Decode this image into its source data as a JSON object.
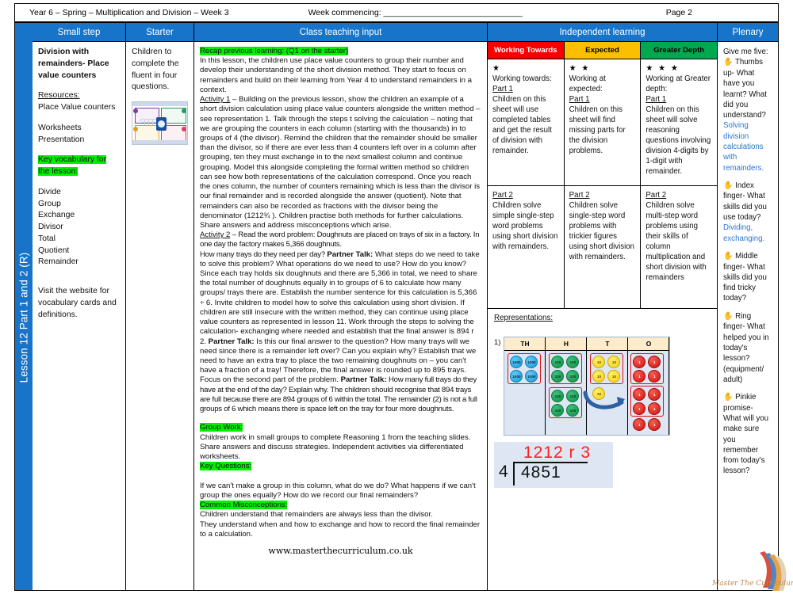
{
  "meta": {
    "title": "Year 6 – Spring – Multiplication and Division – Week 3",
    "week_commencing": "Week commencing: ______________________________",
    "page": "Page 2"
  },
  "spine": {
    "label": "Lesson 12 Part 1 and 2 (R)",
    "color": "#1874c8"
  },
  "headers": {
    "small_step": "Small step",
    "starter": "Starter",
    "teaching": "Class teaching input",
    "independent": "Independent learning",
    "plenary": "Plenary"
  },
  "small_step": {
    "title": "Division with remainders- Place value counters",
    "resources_label": "Resources:",
    "resources_items": "Place Value counters",
    "worksheets": "Worksheets",
    "presentation": "Presentation",
    "vocab_heading": "Key vocabulary for the lesson:",
    "vocab": [
      "Divide",
      "Group",
      "Exchange",
      "Divisor",
      "Total",
      "Quotient",
      "Remainder"
    ],
    "footer": "Visit the website for vocabulary cards and definitions."
  },
  "starter": {
    "text": "Children to complete the fluent in four questions.",
    "thumbnail_name": "fluent-in-four-slide-thumbnail"
  },
  "teaching": {
    "recap_heading": "Recap previous learning: (Q1 on the starter)",
    "intro": "In this lesson, the children use place value counters to group their number and develop their understanding of the short division method. They start to focus on remainders and build on their learning from Year 4 to understand remainders in a context.",
    "activity1_label": "Activity 1",
    "activity1": " – Building on the previous lesson, show the children an example of a short division calculation using place value counters alongside the written method – see representation 1. Talk through the steps t solving the calculation – noting that we are grouping the counters in each column (starting with the thousands) in to groups of 4 (the divisor). Remind the children that the remainder should be smaller than the divisor, so if there are ever less than 4 counters left over in a column after grouping, ten they must exchange in to the next smallest column and continue grouping. Model this alongside completing the formal written method so children can see how both representations of the calculation correspond. Once you reach the ones column, the number of counters remaining which is less than the divisor is our final remainder and is recorded alongside the answer (quotient). Note that remainders can also be recorded as fractions with the divisor being the denominator (1212¾ ). Children practise both methods for further calculations. Share answers and address misconceptions which arise.",
    "activity2_label": "Activity 2",
    "activity2_a": " – Read the word problem: Doughnuts are placed on trays of six in a factory. In one day the factory makes 5,366 doughnuts.",
    "activity2_b": "How many trays do they need per day? ",
    "partner_talk_1_label": "Partner Talk:",
    "activity2_c": " What steps do we need to take to solve this problem? What operations do we need to use? How do you know? Since each tray holds six doughnuts and there are 5,366 in total, we need to share the total number of doughnuts equally in to groups of 6 to calculate how many groups/ trays there are. Establish the number sentence for this calculation is 5,366 ÷ 6. Invite children to model how to solve this calculation using short division. If children are still insecure with the written method, they can continue using place value counters as represented in lesson 11. Work through the steps to solving the calculation- exchanging where needed and establish that the final answer is 894 r 2. ",
    "partner_talk_2_label": "Partner Talk:",
    "activity2_d": " Is this our final answer to the question? How many trays will we need since there is a remainder left over? Can you explain why? Establish that we need to have an extra tray to place the two remaining doughnuts on – you can't have a fraction of a tray! Therefore, the final answer is rounded up to 895 trays. Focus on the second part of the problem. ",
    "partner_talk_3_label": "Partner Talk:",
    "activity2_e": " How many full trays do they have at the end of the day? Explain why. The children should recognise that 894 trays are full because there are 894 groups of 6 within the total. The remainder (2) is not a full groups of 6 which means there is space left on the tray for four more doughnuts.",
    "group_work_heading": "Group Work:",
    "group_work": "Children work in small groups to complete Reasoning 1 from the teaching slides. Share answers and discuss strategies. Independent activities via differentiated worksheets.",
    "key_questions_heading": "Key Questions:",
    "key_questions": "If we can't make a group in this column, what do we do? What happens if we can't group the ones equally? How do we record our final remainders?",
    "misconceptions_heading": "Common Misconceptions:",
    "misconceptions_1": "Children understand that remainders are always less than the divisor.",
    "misconceptions_2": "They understand when and how to exchange and how to record the final remainder to a calculation.",
    "website": "www.masterthecurriculum.co.uk"
  },
  "independent": {
    "bands": [
      {
        "label": "Working Towards",
        "color": "#f90000"
      },
      {
        "label": "Expected",
        "color": "#fcbf00"
      },
      {
        "label": "Greater Depth",
        "color": "#00a84f"
      }
    ],
    "part1": [
      {
        "stars": "★",
        "intro": "Working towards:",
        "part": "Part 1",
        "text": "Children on this sheet will use completed tables and get the result of division with remainder."
      },
      {
        "stars": "★ ★",
        "intro": "Working at expected:",
        "part": "Part 1",
        "text": "Children on this sheet will find missing parts for the division problems."
      },
      {
        "stars": "★ ★ ★",
        "intro": "Working at Greater depth:",
        "part": "Part 1",
        "text": "Children on this sheet will solve reasoning questions involving division 4-digits by 1-digit with remainder."
      }
    ],
    "part2": [
      {
        "part": "Part 2",
        "text": "Children solve simple single-step word problems using short division with remainders."
      },
      {
        "part": "Part 2",
        "text": "Children solve single-step word problems with trickier figures using short division with remainders."
      },
      {
        "part": "Part 2",
        "text": "Children solve multi-step word problems using their skills of column multiplication and short division with remainders"
      }
    ],
    "representations_label": "Representations:",
    "representation_number": "1)",
    "place_value_chart": {
      "columns": [
        "TH",
        "H",
        "T",
        "O"
      ],
      "counters": {
        "TH": {
          "label": "1000",
          "count": 4,
          "color": "#1a9ad8"
        },
        "H": {
          "label": "100",
          "count": 8,
          "color": "#109048"
        },
        "T": {
          "label": "10",
          "count": 5,
          "color": "#f2d010"
        },
        "O": {
          "label": "1",
          "count": 11,
          "color": "#d01010"
        }
      },
      "exchange_arrow": "tens-to-ones-exchange-arrow"
    },
    "short_division": {
      "quotient": "1212 r 3",
      "divisor": "4",
      "dividend": "4851"
    }
  },
  "plenary": {
    "intro": "Give me five:",
    "items": [
      {
        "icon": "hand-icon",
        "question": "Thumbs up- What have you learnt? What did you understand?",
        "answer": "Solving division calculations with remainders."
      },
      {
        "icon": "hand-icon",
        "question": "Index finger- What skills did you use today?",
        "answer": "Dividing, exchanging."
      },
      {
        "icon": "hand-icon",
        "question": "Middle finger- What skills did you find tricky today?",
        "answer": ""
      },
      {
        "icon": "hand-icon",
        "question": "Ring finger- What helped you in today's lesson? (equipment/ adult)",
        "answer": ""
      },
      {
        "icon": "hand-icon",
        "question": "Pinkie promise- What will you make sure you remember from today's lesson?",
        "answer": ""
      }
    ]
  },
  "logo": {
    "text": "Master The Curriculum",
    "name": "master-the-curriculum-logo"
  }
}
